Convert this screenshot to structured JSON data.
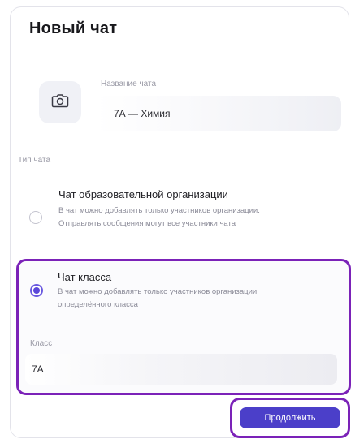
{
  "dialog": {
    "title": "Новый чат",
    "name_field": {
      "label": "Название чата",
      "value": "7А — Химия"
    },
    "chat_type_label": "Тип чата",
    "options": [
      {
        "title": "Чат образовательной организации",
        "description": "В чат можно добавлять только участников организации. Отправлять сообщения могут все участники чата",
        "selected": false
      },
      {
        "title": "Чат класса",
        "description": "В чат можно добавлять только участников организации определённого класса",
        "selected": true
      }
    ],
    "class_field": {
      "label": "Класс",
      "value": "7А"
    },
    "continue_label": "Продолжить"
  },
  "colors": {
    "accent": "#5b47d9",
    "button": "#4b3fc9",
    "highlight_border": "#7b22b8"
  },
  "icons": {
    "avatar_upload": "camera-icon"
  }
}
